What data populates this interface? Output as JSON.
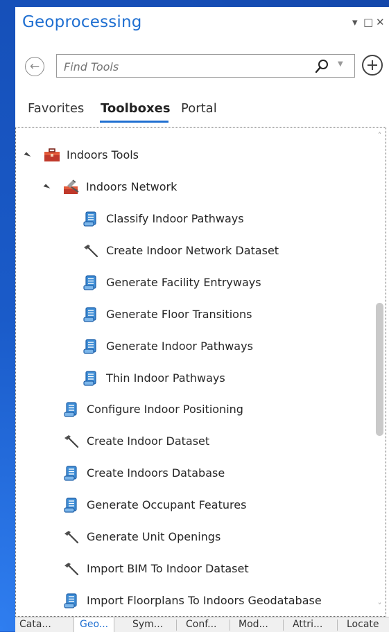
{
  "panel": {
    "title": "Geoprocessing",
    "window_controls": {
      "pin": "▾",
      "maximize": "□",
      "close": "✕"
    }
  },
  "search": {
    "placeholder": "Find Tools",
    "value": ""
  },
  "tabs": [
    {
      "label": "Favorites",
      "active": false
    },
    {
      "label": "Toolboxes",
      "active": true
    },
    {
      "label": "Portal",
      "active": false
    }
  ],
  "tree": [
    {
      "label": "Indoors Tools",
      "icon": "toolbox-icon",
      "level": 0,
      "expanded": true
    },
    {
      "label": "Indoors Network",
      "icon": "toolset-icon",
      "level": 1,
      "expanded": true
    },
    {
      "label": "Classify Indoor Pathways",
      "icon": "script-tool-icon",
      "level": 2
    },
    {
      "label": "Create Indoor Network Dataset",
      "icon": "hammer-tool-icon",
      "level": 2
    },
    {
      "label": "Generate Facility Entryways",
      "icon": "script-tool-icon",
      "level": 2
    },
    {
      "label": "Generate Floor Transitions",
      "icon": "script-tool-icon",
      "level": 2
    },
    {
      "label": "Generate Indoor Pathways",
      "icon": "script-tool-icon",
      "level": 2
    },
    {
      "label": "Thin Indoor Pathways",
      "icon": "script-tool-icon",
      "level": 2
    },
    {
      "label": "Configure Indoor Positioning",
      "icon": "script-tool-icon",
      "level": 1
    },
    {
      "label": "Create Indoor Dataset",
      "icon": "hammer-tool-icon",
      "level": 1
    },
    {
      "label": "Create Indoors Database",
      "icon": "script-tool-icon",
      "level": 1
    },
    {
      "label": "Generate Occupant Features",
      "icon": "script-tool-icon",
      "level": 1
    },
    {
      "label": "Generate Unit Openings",
      "icon": "hammer-tool-icon",
      "level": 1
    },
    {
      "label": "Import BIM To Indoor Dataset",
      "icon": "hammer-tool-icon",
      "level": 1
    },
    {
      "label": "Import Floorplans To Indoors Geodatabase",
      "icon": "script-tool-icon",
      "level": 1
    }
  ],
  "bottom_tabs": [
    {
      "label": "Cata...",
      "active": false
    },
    {
      "label": "Geo...",
      "active": true
    },
    {
      "label": "Sym...",
      "active": false
    },
    {
      "label": "Conf...",
      "active": false
    },
    {
      "label": "Mod...",
      "active": false
    },
    {
      "label": "Attri...",
      "active": false
    },
    {
      "label": "Locate",
      "active": false
    }
  ],
  "colors": {
    "accent": "#1f6fd1",
    "background": "#1c5fd0",
    "toolbox_red": "#c0392b"
  }
}
